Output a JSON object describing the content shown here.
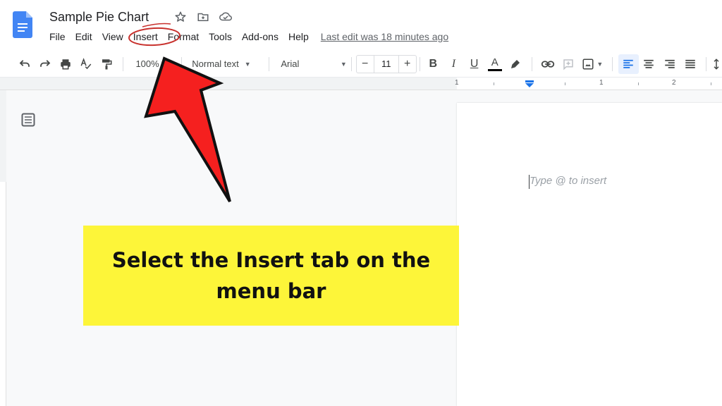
{
  "header": {
    "doc_title": "Sample Pie Chart",
    "title_icons": [
      "star-icon",
      "move-to-folder-icon",
      "cloud-status-icon"
    ],
    "menu": [
      "File",
      "Edit",
      "View",
      "Insert",
      "Format",
      "Tools",
      "Add-ons",
      "Help"
    ],
    "last_edit": "Last edit was 18 minutes ago"
  },
  "toolbar": {
    "zoom": "100%",
    "style": "Normal text",
    "font": "Arial",
    "font_size": "11",
    "minus": "−",
    "plus": "+",
    "bold": "B",
    "italic": "I",
    "underline": "U",
    "text_color": "A",
    "active_alignment": "left"
  },
  "ruler": {
    "labels": [
      "1",
      "1",
      "2"
    ]
  },
  "document": {
    "placeholder": "Type @ to insert"
  },
  "annotation": {
    "callout_text": "Select the Insert tab on the menu bar",
    "highlighted_menu_item": "Insert",
    "callout_color": "#fdf539",
    "arrow_color": "#f5201f"
  },
  "colors": {
    "docs_blue": "#4285f4",
    "accent_blue": "#1a73e8"
  }
}
